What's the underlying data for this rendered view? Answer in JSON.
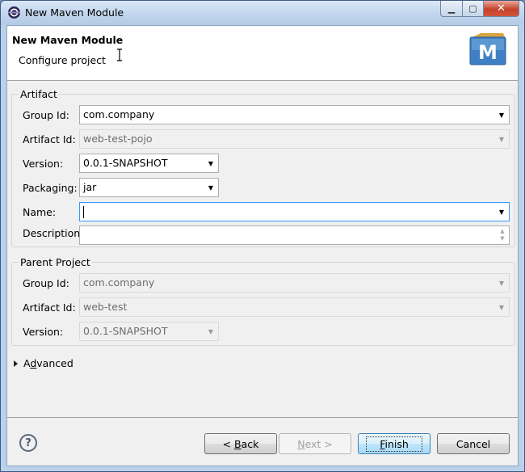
{
  "window": {
    "title": "New Maven Module"
  },
  "header": {
    "title": "New Maven Module",
    "description": "Configure project"
  },
  "artifact": {
    "legend": "Artifact",
    "group_id_label": "Group Id:",
    "group_id_value": "com.company",
    "artifact_id_label": "Artifact Id:",
    "artifact_id_value": "web-test-pojo",
    "version_label": "Version:",
    "version_value": "0.0.1-SNAPSHOT",
    "packaging_label": "Packaging:",
    "packaging_value": "jar",
    "name_label": "Name:",
    "name_value": "",
    "description_label": "Description:",
    "description_value": ""
  },
  "parent": {
    "legend": "Parent Project",
    "group_id_label": "Group Id:",
    "group_id_value": "com.company",
    "artifact_id_label": "Artifact Id:",
    "artifact_id_value": "web-test",
    "version_label": "Version:",
    "version_value": "0.0.1-SNAPSHOT"
  },
  "advanced": {
    "label_first": "A",
    "label_mnemonic": "d",
    "label_rest": "vanced"
  },
  "buttons": {
    "back_prefix": "< ",
    "back_mnemonic": "B",
    "back_rest": "ack",
    "next_mnemonic": "N",
    "next_rest": "ext >",
    "finish_mnemonic": "F",
    "finish_rest": "inish",
    "cancel": "Cancel"
  },
  "icons": {
    "app": "eclipse-icon",
    "logo": "maven-logo-icon",
    "help": "help-icon"
  }
}
